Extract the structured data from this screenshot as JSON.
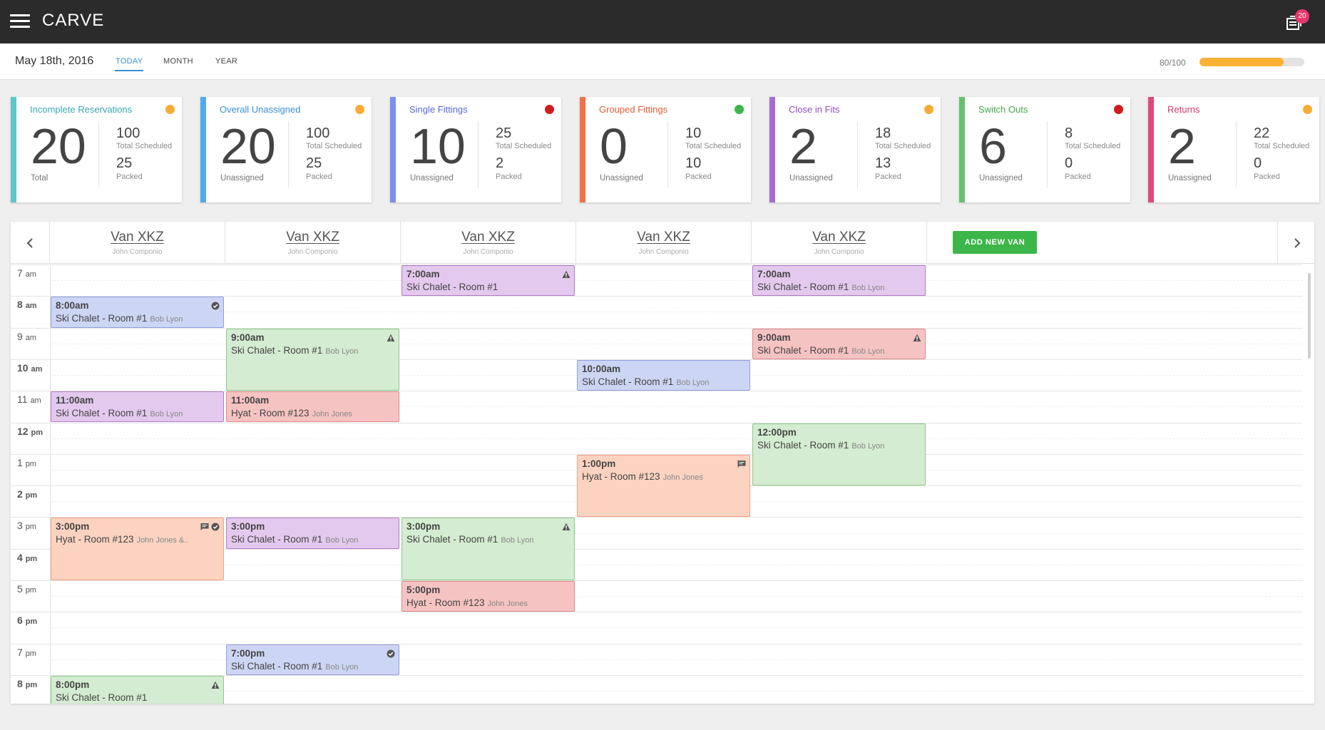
{
  "app": {
    "title": "CARVE",
    "notifications_count": "20"
  },
  "header": {
    "date": "May 18th, 2016",
    "tabs": [
      {
        "label": "TODAY",
        "active": true
      },
      {
        "label": "MONTH",
        "active": false
      },
      {
        "label": "YEAR",
        "active": false
      }
    ],
    "progress": {
      "label": "80/100",
      "value": 0.8,
      "color": "#f9b233"
    }
  },
  "cards": [
    {
      "title": "Incomplete Reservations",
      "accent": "#5ec5cd",
      "title_color": "#3aa9b3",
      "dot": "#f6ac36",
      "big": "20",
      "big_label": "Total",
      "n1": "100",
      "l1": "Total Scheduled",
      "n2": "25",
      "l2": "Packed"
    },
    {
      "title": "Overall Unassigned",
      "accent": "#52a9ef",
      "title_color": "#3a8fd6",
      "dot": "#f6ac36",
      "big": "20",
      "big_label": "Unassigned",
      "n1": "100",
      "l1": "Total Scheduled",
      "n2": "25",
      "l2": "Packed"
    },
    {
      "title": "Single Fittings",
      "accent": "#7b8ff0",
      "title_color": "#5869d8",
      "dot": "#d01c1c",
      "big": "10",
      "big_label": "Unassigned",
      "n1": "25",
      "l1": "Total Scheduled",
      "n2": "2",
      "l2": "Packed"
    },
    {
      "title": "Grouped Fittings",
      "accent": "#f4704a",
      "title_color": "#e55b32",
      "dot": "#3cb648",
      "big": "0",
      "big_label": "Unassigned",
      "n1": "10",
      "l1": "Total Scheduled",
      "n2": "10",
      "l2": "Packed"
    },
    {
      "title": "Close in Fits",
      "accent": "#a76cd0",
      "title_color": "#8f4ebf",
      "dot": "#f6ac36",
      "big": "2",
      "big_label": "Unassigned",
      "n1": "18",
      "l1": "Total Scheduled",
      "n2": "13",
      "l2": "Packed"
    },
    {
      "title": "Switch Outs",
      "accent": "#66c16c",
      "title_color": "#45a84b",
      "dot": "#d01c1c",
      "big": "6",
      "big_label": "Unassigned",
      "n1": "8",
      "l1": "Total Scheduled",
      "n2": "0",
      "l2": "Packed"
    },
    {
      "title": "Returns",
      "accent": "#e0487b",
      "title_color": "#d43a6c",
      "dot": "#f6ac36",
      "big": "2",
      "big_label": "Unassigned",
      "n1": "22",
      "l1": "Total Scheduled",
      "n2": "0",
      "l2": "Packed"
    }
  ],
  "vans": [
    {
      "name": "Van XKZ",
      "driver": "John Componio"
    },
    {
      "name": "Van XKZ",
      "driver": "John Componio"
    },
    {
      "name": "Van XKZ",
      "driver": "John Componio"
    },
    {
      "name": "Van XKZ",
      "driver": "John Componio"
    },
    {
      "name": "Van XKZ",
      "driver": "John Componio"
    }
  ],
  "add_van_label": "ADD NEW VAN",
  "hours": [
    {
      "num": "7",
      "suffix": "am",
      "bold": false
    },
    {
      "num": "8",
      "suffix": "am",
      "bold": true
    },
    {
      "num": "9",
      "suffix": "am",
      "bold": false
    },
    {
      "num": "10",
      "suffix": "am",
      "bold": true
    },
    {
      "num": "11",
      "suffix": "am",
      "bold": false
    },
    {
      "num": "12",
      "suffix": "pm",
      "bold": true
    },
    {
      "num": "1",
      "suffix": "pm",
      "bold": false
    },
    {
      "num": "2",
      "suffix": "pm",
      "bold": true
    },
    {
      "num": "3",
      "suffix": "pm",
      "bold": false
    },
    {
      "num": "4",
      "suffix": "pm",
      "bold": true
    },
    {
      "num": "5",
      "suffix": "pm",
      "bold": false
    },
    {
      "num": "6",
      "suffix": "pm",
      "bold": true
    },
    {
      "num": "7",
      "suffix": "pm",
      "bold": false
    },
    {
      "num": "8",
      "suffix": "pm",
      "bold": true
    }
  ],
  "event_colors": {
    "purple": {
      "bg": "#e4c9ee",
      "border": "#b07ac8"
    },
    "blue": {
      "bg": "#cdd5f4",
      "border": "#8f9fe0"
    },
    "green": {
      "bg": "#d4ecd1",
      "border": "#8fc98a"
    },
    "red": {
      "bg": "#f6c3c3",
      "border": "#e08888"
    },
    "orange": {
      "bg": "#fcd3c0",
      "border": "#f1a283"
    }
  },
  "events": [
    {
      "van": 0,
      "start": 8.0,
      "end": 9.0,
      "color": "blue",
      "time": "8:00am",
      "title": "Ski Chalet - Room #1",
      "person": "Bob Lyon",
      "icons": [
        "check-icon"
      ]
    },
    {
      "van": 0,
      "start": 11.0,
      "end": 12.0,
      "color": "purple",
      "time": "11:00am",
      "title": "Ski Chalet - Room #1",
      "person": "Bob Lyon",
      "icons": []
    },
    {
      "van": 0,
      "start": 15.0,
      "end": 17.0,
      "color": "orange",
      "time": "3:00pm",
      "title": "Hyat - Room #123",
      "person": "John Jones &..",
      "icons": [
        "comment-icon",
        "check-icon"
      ]
    },
    {
      "van": 0,
      "start": 20.0,
      "end": 21.0,
      "color": "green",
      "time": "8:00pm",
      "title": "Ski Chalet - Room #1",
      "person": "",
      "icons": [
        "warning-icon"
      ]
    },
    {
      "van": 1,
      "start": 9.0,
      "end": 11.0,
      "color": "green",
      "time": "9:00am",
      "title": "Ski Chalet - Room #1",
      "person": "Bob Lyon",
      "icons": [
        "warning-icon"
      ]
    },
    {
      "van": 1,
      "start": 11.0,
      "end": 12.0,
      "color": "red",
      "time": "11:00am",
      "title": "Hyat - Room #123",
      "person": "John Jones",
      "icons": []
    },
    {
      "van": 1,
      "start": 15.0,
      "end": 16.0,
      "color": "purple",
      "time": "3:00pm",
      "title": "Ski Chalet - Room #1",
      "person": "Bob Lyon",
      "icons": []
    },
    {
      "van": 1,
      "start": 19.0,
      "end": 20.0,
      "color": "blue",
      "time": "7:00pm",
      "title": "Ski Chalet - Room #1",
      "person": "Bob Lyon",
      "icons": [
        "check-icon"
      ]
    },
    {
      "van": 2,
      "start": 7.0,
      "end": 8.0,
      "color": "purple",
      "time": "7:00am",
      "title": "Ski Chalet - Room #1",
      "person": "",
      "icons": [
        "warning-icon"
      ]
    },
    {
      "van": 2,
      "start": 15.0,
      "end": 17.0,
      "color": "green",
      "time": "3:00pm",
      "title": "Ski Chalet - Room #1",
      "person": "Bob Lyon",
      "icons": [
        "warning-icon"
      ]
    },
    {
      "van": 2,
      "start": 17.0,
      "end": 18.0,
      "color": "red",
      "time": "5:00pm",
      "title": "Hyat - Room #123",
      "person": "John Jones",
      "icons": []
    },
    {
      "van": 3,
      "start": 10.0,
      "end": 11.0,
      "color": "blue",
      "time": "10:00am",
      "title": "Ski Chalet - Room #1",
      "person": "Bob Lyon",
      "icons": []
    },
    {
      "van": 3,
      "start": 13.0,
      "end": 15.0,
      "color": "orange",
      "time": "1:00pm",
      "title": "Hyat - Room #123",
      "person": "John Jones",
      "icons": [
        "comment-icon"
      ]
    },
    {
      "van": 4,
      "start": 7.0,
      "end": 8.0,
      "color": "purple",
      "time": "7:00am",
      "title": "Ski Chalet - Room #1",
      "person": "Bob Lyon",
      "icons": []
    },
    {
      "van": 4,
      "start": 9.0,
      "end": 10.0,
      "color": "red",
      "time": "9:00am",
      "title": "Ski Chalet - Room #1",
      "person": "Bob Lyon",
      "icons": [
        "warning-icon"
      ]
    },
    {
      "van": 4,
      "start": 12.0,
      "end": 14.0,
      "color": "green",
      "time": "12:00pm",
      "title": "Ski Chalet - Room #1",
      "person": "Bob Lyon",
      "icons": []
    }
  ]
}
